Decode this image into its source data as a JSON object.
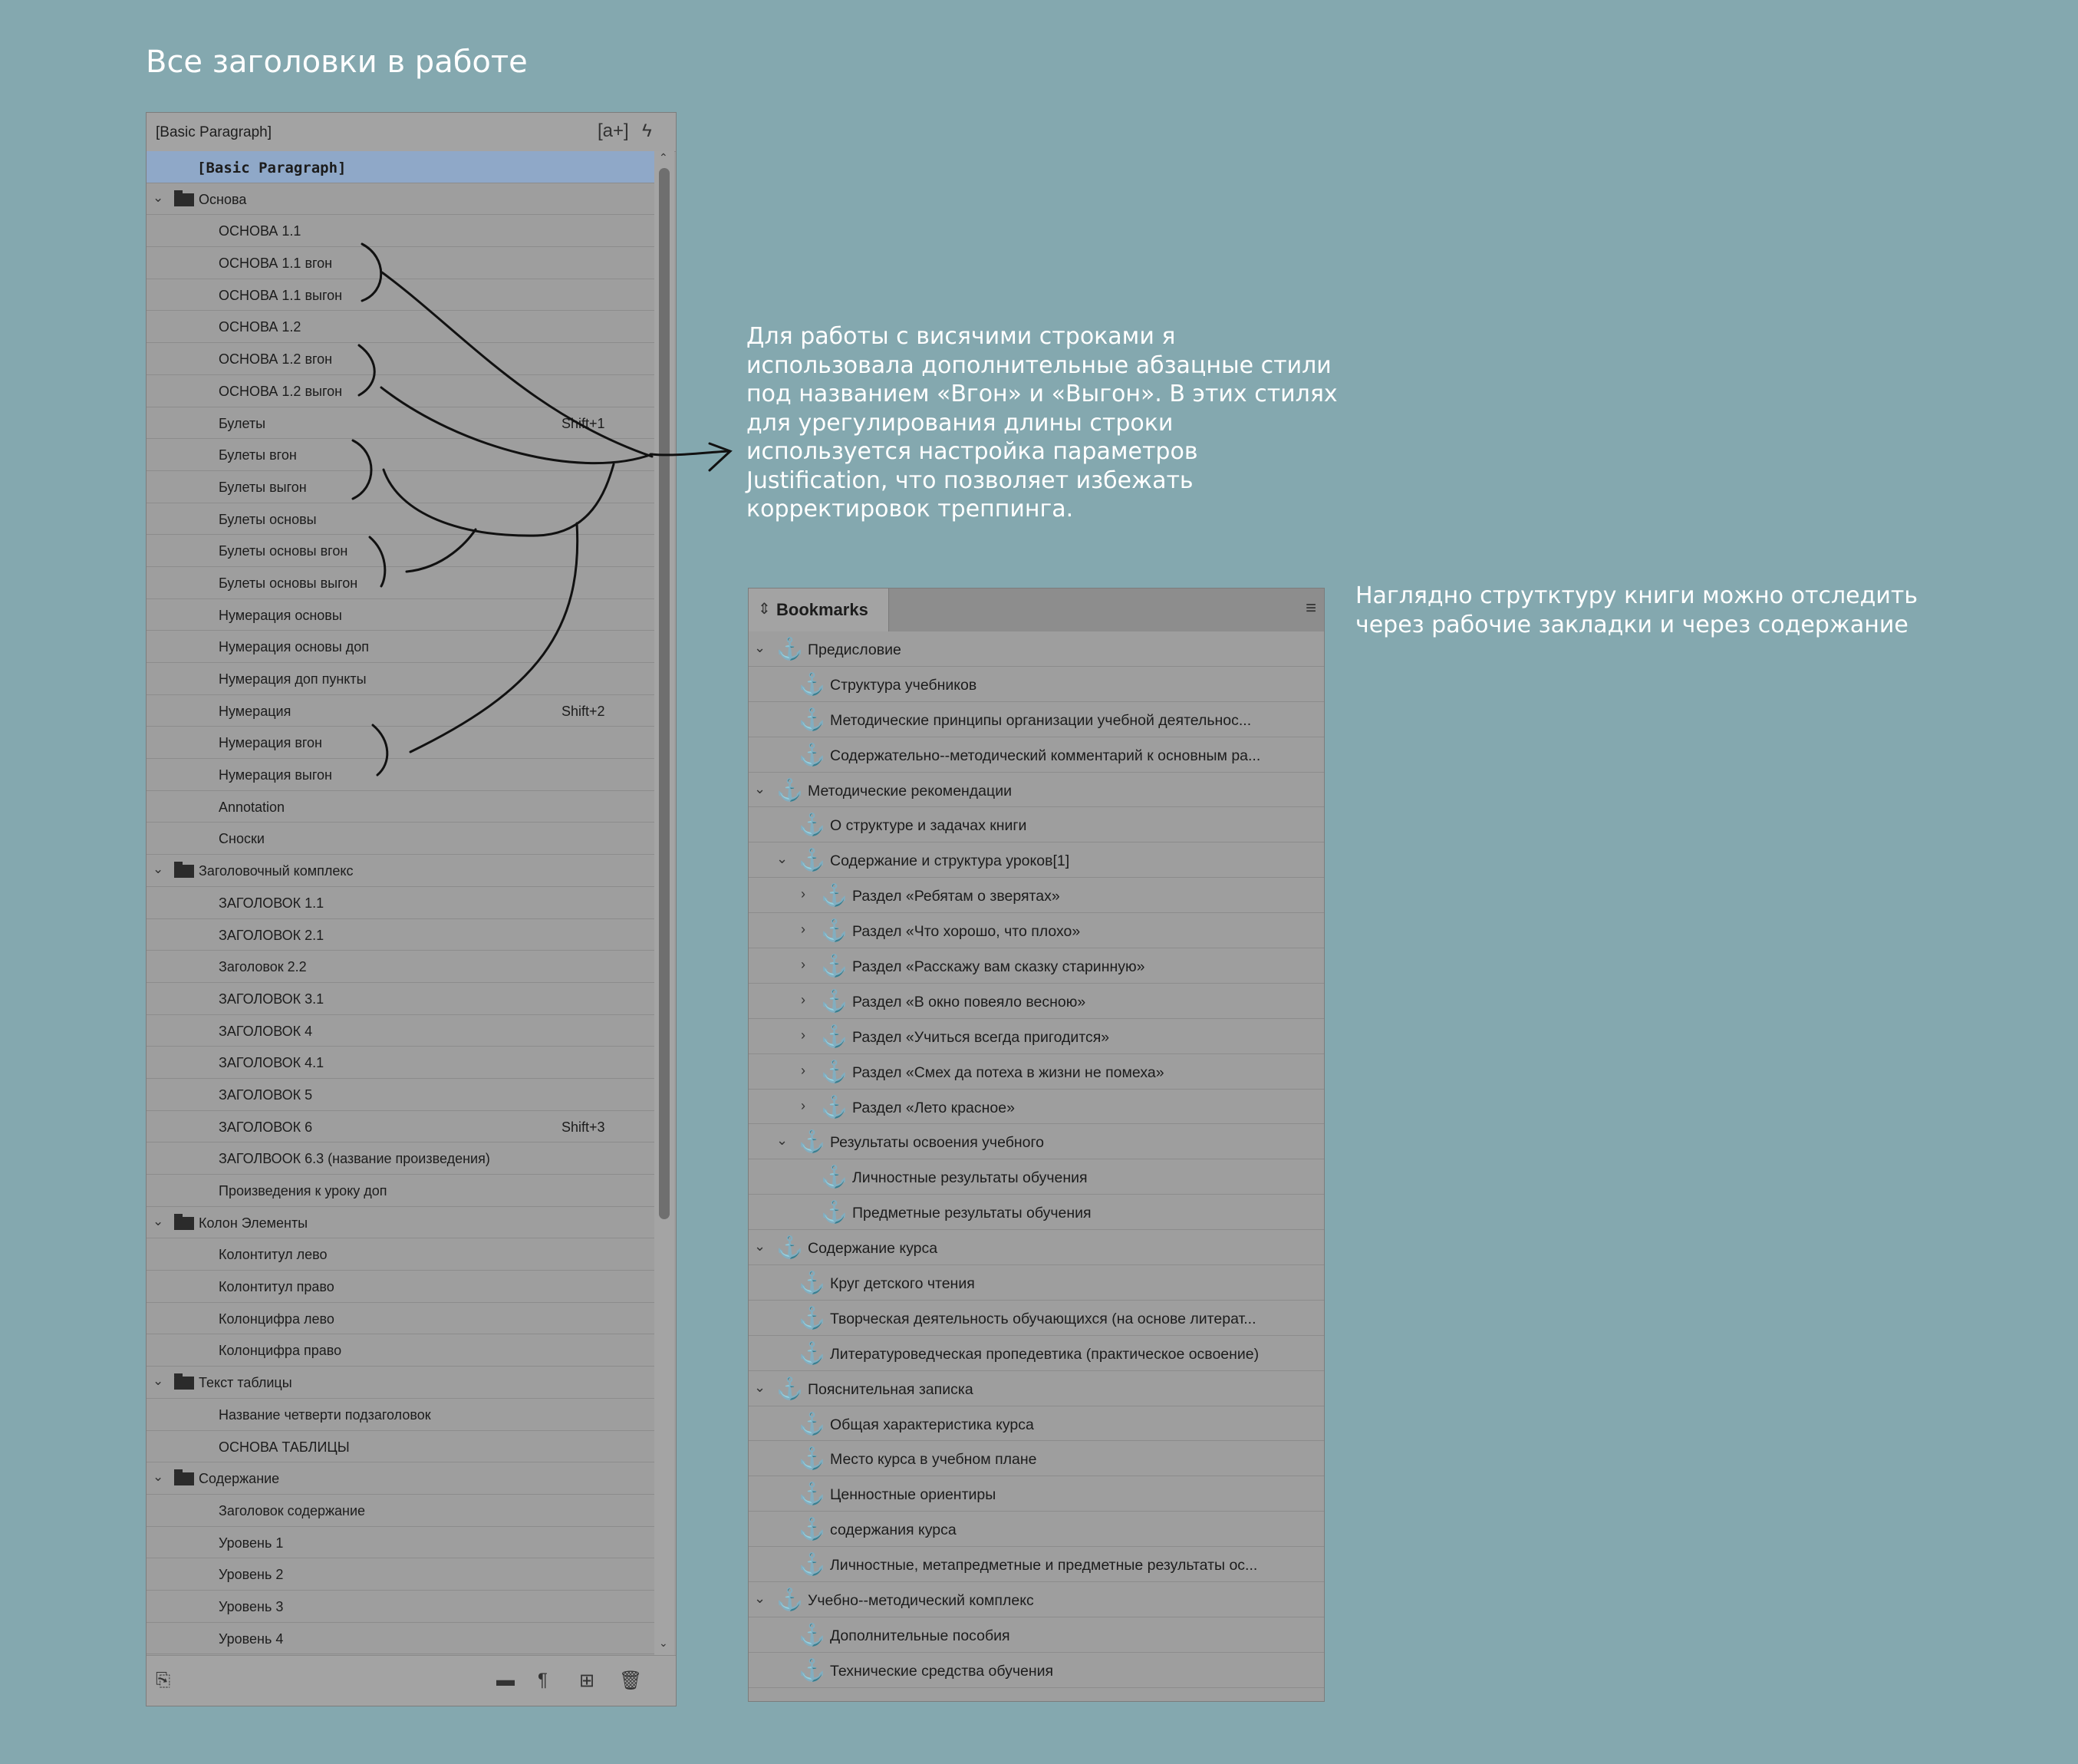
{
  "heading": "Все заголовки в работе",
  "note_orphans": "Для работы с висячими строками я\nиспользовала дополнительные абзацные стили\nпод названием «Вгон» и «Выгон». В этих стилях\nдля урегулирования длины строки\nиспользуется настройка параметров\nJustification, что позволяет избежать\nкорректировок треппинга.",
  "note_bookmarks": "Наглядно струтктуру книги можно отследить\nчерез рабочие закладки и через содержание",
  "styles_panel": {
    "current_style": "[Basic Paragraph]",
    "header_icons": [
      "[a+]",
      "lightning-icon"
    ],
    "rows": [
      {
        "type": "selected",
        "label": "[Basic Paragraph]"
      },
      {
        "type": "group",
        "label": "Основа"
      },
      {
        "type": "style",
        "label": "ОСНОВА 1.1"
      },
      {
        "type": "style",
        "label": "ОСНОВА 1.1 вгон"
      },
      {
        "type": "style",
        "label": "ОСНОВА 1.1 выгон"
      },
      {
        "type": "style",
        "label": "ОСНОВА 1.2"
      },
      {
        "type": "style",
        "label": "ОСНОВА 1.2 вгон"
      },
      {
        "type": "style",
        "label": "ОСНОВА 1.2 выгон"
      },
      {
        "type": "style",
        "label": "Булеты",
        "shortcut": "Shift+1"
      },
      {
        "type": "style",
        "label": "Булеты вгон"
      },
      {
        "type": "style",
        "label": "Булеты выгон"
      },
      {
        "type": "style",
        "label": "Булеты основы"
      },
      {
        "type": "style",
        "label": "Булеты основы вгон"
      },
      {
        "type": "style",
        "label": "Булеты основы выгон"
      },
      {
        "type": "style",
        "label": "Нумерация основы"
      },
      {
        "type": "style",
        "label": "Нумерация основы доп"
      },
      {
        "type": "style",
        "label": "Нумерация доп пункты"
      },
      {
        "type": "style",
        "label": "Нумерация",
        "shortcut": "Shift+2"
      },
      {
        "type": "style",
        "label": "Нумерация вгон"
      },
      {
        "type": "style",
        "label": "Нумерация выгон"
      },
      {
        "type": "style",
        "label": "Annotation"
      },
      {
        "type": "style",
        "label": "Сноски"
      },
      {
        "type": "group",
        "label": "Заголовочный комплекс"
      },
      {
        "type": "style",
        "label": "ЗАГОЛОВОК 1.1"
      },
      {
        "type": "style",
        "label": "ЗАГОЛОВОК 2.1"
      },
      {
        "type": "style",
        "label": "Заголовок 2.2"
      },
      {
        "type": "style",
        "label": "ЗАГОЛОВОК 3.1"
      },
      {
        "type": "style",
        "label": "ЗАГОЛОВОК 4"
      },
      {
        "type": "style",
        "label": "ЗАГОЛОВОК 4.1"
      },
      {
        "type": "style",
        "label": "ЗАГОЛОВОК 5"
      },
      {
        "type": "style",
        "label": "ЗАГОЛОВОК 6",
        "shortcut": "Shift+3"
      },
      {
        "type": "style",
        "label": "ЗАГОЛВООК 6.3 (название произведения)"
      },
      {
        "type": "style",
        "label": "Произведения к уроку доп"
      },
      {
        "type": "group",
        "label": "Колон Элементы"
      },
      {
        "type": "style",
        "label": "Колонтитул лево"
      },
      {
        "type": "style",
        "label": "Колонтитул право"
      },
      {
        "type": "style",
        "label": "Колонцифра лево"
      },
      {
        "type": "style",
        "label": "Колонцифра право"
      },
      {
        "type": "group",
        "label": "Текст таблицы"
      },
      {
        "type": "style",
        "label": "Название четверти подзаголовок"
      },
      {
        "type": "style",
        "label": "ОСНОВА ТАБЛИЦЫ"
      },
      {
        "type": "group",
        "label": "Содержание"
      },
      {
        "type": "style",
        "label": "Заголовок содержание"
      },
      {
        "type": "style",
        "label": "Уровень 1"
      },
      {
        "type": "style",
        "label": "Уровень 2"
      },
      {
        "type": "style",
        "label": "Уровень 3"
      },
      {
        "type": "style",
        "label": "Уровень 4"
      }
    ]
  },
  "bookmarks_panel": {
    "tab_label": "Bookmarks",
    "rows": [
      {
        "level": 0,
        "chevron": "down",
        "label": "Предисловие"
      },
      {
        "level": 1,
        "chevron": "",
        "label": "Структура учебников"
      },
      {
        "level": 1,
        "chevron": "",
        "label": "Методические принципы организации учебной деятельнос..."
      },
      {
        "level": 1,
        "chevron": "",
        "label": "Содержательно--методический комментарий к основным ра..."
      },
      {
        "level": 0,
        "chevron": "down",
        "label": "Методические рекомендации"
      },
      {
        "level": 1,
        "chevron": "",
        "label": "О структуре и задачах книги"
      },
      {
        "level": 1,
        "chevron": "down",
        "label": "Содержание и структура уроков[1]"
      },
      {
        "level": 2,
        "chevron": "right",
        "label": "Раздел «Ребятам о зверятах»"
      },
      {
        "level": 2,
        "chevron": "right",
        "label": "Раздел «Что хорошо, что плохо»"
      },
      {
        "level": 2,
        "chevron": "right",
        "label": "Раздел «Расскажу вам сказку старинную»"
      },
      {
        "level": 2,
        "chevron": "right",
        "label": "Раздел «В окно повеяло весною»"
      },
      {
        "level": 2,
        "chevron": "right",
        "label": "Раздел «Учиться всегда пригодится»"
      },
      {
        "level": 2,
        "chevron": "right",
        "label": "Раздел «Смех да потеха в жизни не помеха»"
      },
      {
        "level": 2,
        "chevron": "right",
        "label": "Раздел «Лето красное»"
      },
      {
        "level": 1,
        "chevron": "down",
        "label": "Результаты освоения учебного"
      },
      {
        "level": 2,
        "chevron": "",
        "label": "Личностные результаты обучения"
      },
      {
        "level": 2,
        "chevron": "",
        "label": "Предметные результаты обучения"
      },
      {
        "level": 0,
        "chevron": "down",
        "label": "Содержание курса"
      },
      {
        "level": 1,
        "chevron": "",
        "label": "Круг детского чтения"
      },
      {
        "level": 1,
        "chevron": "",
        "label": "Творческая деятельность обучающихся (на основе литерат..."
      },
      {
        "level": 1,
        "chevron": "",
        "label": "Литературоведческая пропедевтика (практическое освоение)"
      },
      {
        "level": 0,
        "chevron": "down",
        "label": "Пояснительная записка"
      },
      {
        "level": 1,
        "chevron": "",
        "label": "Общая характеристика курса"
      },
      {
        "level": 1,
        "chevron": "",
        "label": "Место курса в учебном плане"
      },
      {
        "level": 1,
        "chevron": "",
        "label": "Ценностные ориентиры"
      },
      {
        "level": 1,
        "chevron": "",
        "label": "содержания курса"
      },
      {
        "level": 1,
        "chevron": "",
        "label": "Личностные, метапредметные и предметные результаты ос..."
      },
      {
        "level": 0,
        "chevron": "down",
        "label": "Учебно--методический комплекс"
      },
      {
        "level": 1,
        "chevron": "",
        "label": "Дополнительные пособия"
      },
      {
        "level": 1,
        "chevron": "",
        "label": "Технические средства обучения"
      }
    ]
  },
  "colors": {
    "background": "#84a8af",
    "panel": "#9e9e9e",
    "selection": "#8fa8c8",
    "annotation_text": "#ffffff"
  }
}
